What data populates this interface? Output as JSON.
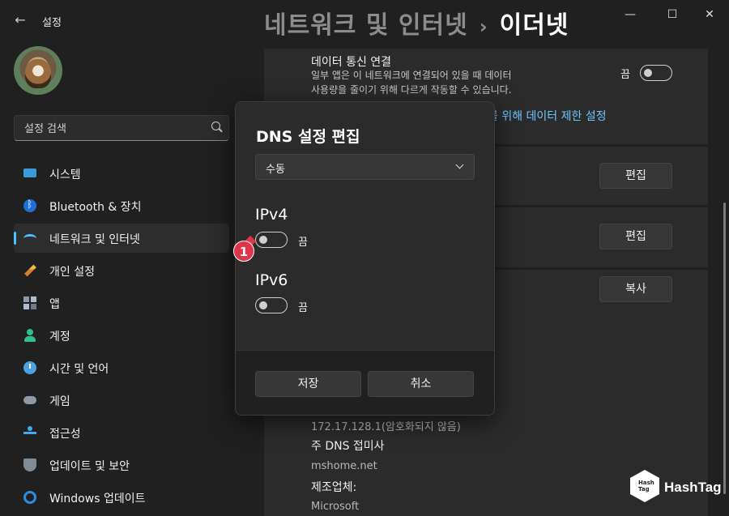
{
  "window": {
    "app_title": "설정",
    "minimize": "—",
    "maximize": "☐",
    "close": "✕"
  },
  "heading": {
    "parent": "네트워크 및 인터넷",
    "separator": "›",
    "current": "이더넷"
  },
  "search": {
    "placeholder": "설정 검색"
  },
  "sidebar": {
    "items": [
      {
        "label": "시스템",
        "icon": "system-icon"
      },
      {
        "label": "Bluetooth & 장치",
        "icon": "bluetooth-icon"
      },
      {
        "label": "네트워크 및 인터넷",
        "icon": "wifi-icon",
        "active": true
      },
      {
        "label": "개인 설정",
        "icon": "brush-icon"
      },
      {
        "label": "앱",
        "icon": "apps-icon"
      },
      {
        "label": "계정",
        "icon": "account-icon"
      },
      {
        "label": "시간 및 언어",
        "icon": "time-icon"
      },
      {
        "label": "게임",
        "icon": "gamepad-icon"
      },
      {
        "label": "접근성",
        "icon": "accessibility-icon"
      },
      {
        "label": "업데이트 및 보안",
        "icon": "shield-icon"
      },
      {
        "label": "Windows 업데이트",
        "icon": "update-icon"
      }
    ]
  },
  "main": {
    "metered": {
      "title": "데이터 통신 연결",
      "desc_line1": "일부 앱은 이 네트워크에 연결되어 있을 때 데이터",
      "desc_line2": "사용량을 줄이기 위해 다르게 작동할 수 있습니다.",
      "toggle_label": "끔"
    },
    "data_limit_link": "를 위해 데이터 제한 설정",
    "edit_button_1": "편집",
    "edit_button_2": "편집",
    "copy_button": "복사",
    "details": {
      "dns_value": "172.17.128.1(암호화되지 않음)",
      "suffix_label": "주 DNS 접미사",
      "suffix_value": "mshome.net",
      "manufacturer_label": "제조업체:",
      "manufacturer_value": "Microsoft"
    }
  },
  "dialog": {
    "title": "DNS 설정 편집",
    "mode_value": "수동",
    "ipv4": {
      "label": "IPv4",
      "toggle_label": "끔"
    },
    "ipv6": {
      "label": "IPv6",
      "toggle_label": "끔"
    },
    "save_label": "저장",
    "cancel_label": "취소"
  },
  "marker": {
    "number": "1",
    "color": "#e0344a"
  },
  "watermark": {
    "text": "HashTag",
    "cube_line1": "Hash",
    "cube_line2": "Tag"
  },
  "colors": {
    "accent": "#4cc2ff",
    "link": "#6cc6ff",
    "background": "#202020"
  }
}
